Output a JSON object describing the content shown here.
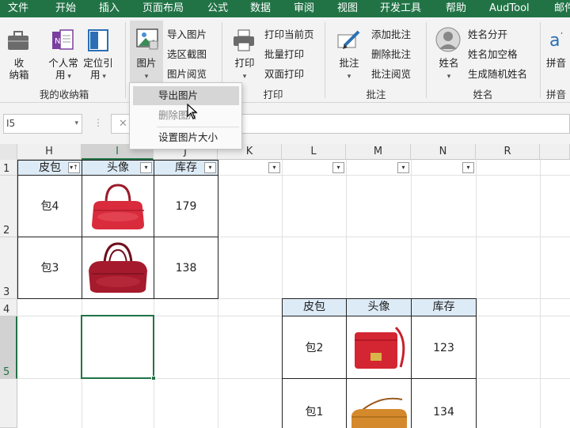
{
  "ribbon_tabs": [
    "文件",
    "开始",
    "插入",
    "页面布局",
    "公式",
    "数据",
    "审阅",
    "视图",
    "开发工具",
    "帮助",
    "AudTool",
    "邮件"
  ],
  "ribbon": {
    "box_group": {
      "collect_label": "收\n纳箱",
      "personal_label": "个人常\n用",
      "locate_label": "定位引\n用",
      "group_label": "我的收纳箱"
    },
    "picture_group": {
      "picture_label": "图片",
      "import": "导入图片",
      "crop": "选区截图",
      "browse": "图片阅览"
    },
    "print_group": {
      "print_label": "打印",
      "print_current": "打印当前页",
      "batch_print": "批量打印",
      "duplex_print": "双面打印",
      "group_label": "打印"
    },
    "comment_group": {
      "comment_label": "批注",
      "add": "添加批注",
      "delete": "删除批注",
      "browse": "批注阅览",
      "group_label": "批注"
    },
    "name_group": {
      "name_label": "姓名",
      "split": "姓名分开",
      "add_space": "姓名加空格",
      "random": "生成随机姓名",
      "group_label": "姓名"
    },
    "pinyin_group": {
      "pinyin_label": "拼音",
      "group_label": "拼音"
    }
  },
  "dropdown": {
    "items": [
      "导出图片",
      "删除图片",
      "设置图片大小"
    ]
  },
  "name_box": "I5",
  "formula_x": "✕",
  "columns": [
    "H",
    "I",
    "J",
    "K",
    "L",
    "M",
    "N",
    "R"
  ],
  "rows": [
    "1",
    "2",
    "3",
    "4",
    "5"
  ],
  "table1": {
    "headers": [
      "皮包",
      "头像",
      "库存"
    ],
    "rows": [
      {
        "name": "包4",
        "stock": "179"
      },
      {
        "name": "包3",
        "stock": "138"
      }
    ]
  },
  "table2": {
    "headers": [
      "皮包",
      "头像",
      "库存"
    ],
    "rows": [
      {
        "name": "包2",
        "stock": "123"
      },
      {
        "name": "包1",
        "stock": "134"
      }
    ]
  },
  "colors": {
    "accent": "#217346",
    "header_fill": "#ddebf7",
    "selection": "#217346"
  }
}
